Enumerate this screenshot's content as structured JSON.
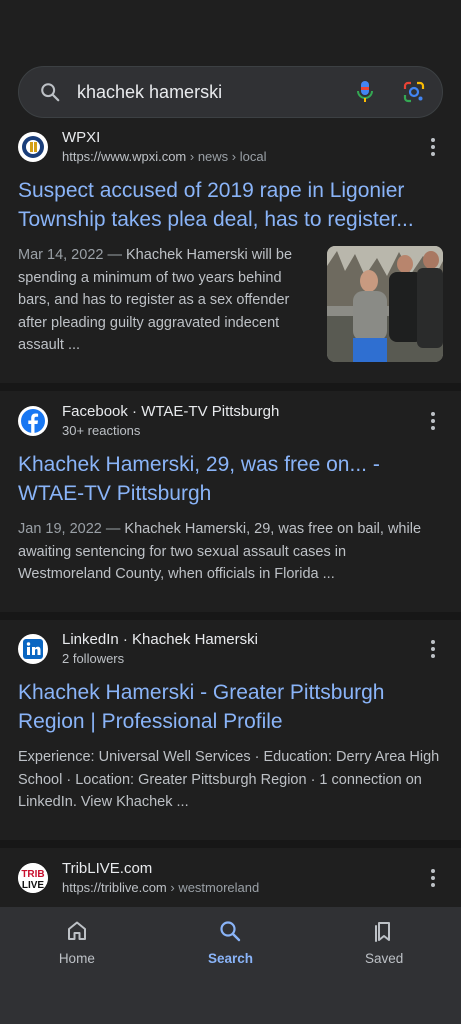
{
  "search": {
    "query": "khachek hamerski"
  },
  "results": [
    {
      "source": "WPXI",
      "url": "https://www.wpxi.com",
      "path": " › news › local",
      "title": "Suspect accused of 2019 rape in Ligonier Township takes plea deal, has to register...",
      "date": "Mar 14, 2022 —",
      "snippet": " Khachek Hamerski will be spending a minimum of two years behind bars, and has to register as a sex offender after pleading guilty aggravated indecent assault ..."
    },
    {
      "source": "Facebook · WTAE-TV Pittsburgh",
      "meta": "30+ reactions",
      "title": "Khachek Hamerski, 29, was free on... - WTAE-TV Pittsburgh",
      "date": "Jan 19, 2022 —",
      "snippet": " Khachek Hamerski, 29, was free on bail, while awaiting sentencing for two sexual assault cases in Westmoreland County, when officials in Florida ..."
    },
    {
      "source": "LinkedIn · Khachek Hamerski",
      "meta": "2 followers",
      "title": "Khachek Hamerski - Greater Pittsburgh Region | Professional Profile",
      "snippet": "Experience: Universal Well Services · Education: Derry Area High School · Location: Greater Pittsburgh Region · 1 connection on LinkedIn. View Khachek ..."
    },
    {
      "source": "TribLIVE.com",
      "url": "https://triblive.com",
      "path": " › westmoreland",
      "logo_text": "TRIB LIVE"
    }
  ],
  "nav": {
    "home": "Home",
    "search": "Search",
    "saved": "Saved"
  },
  "colors": {
    "link": "#8ab4f8",
    "background": "#1f1f1f",
    "nav_bg": "#303134"
  }
}
